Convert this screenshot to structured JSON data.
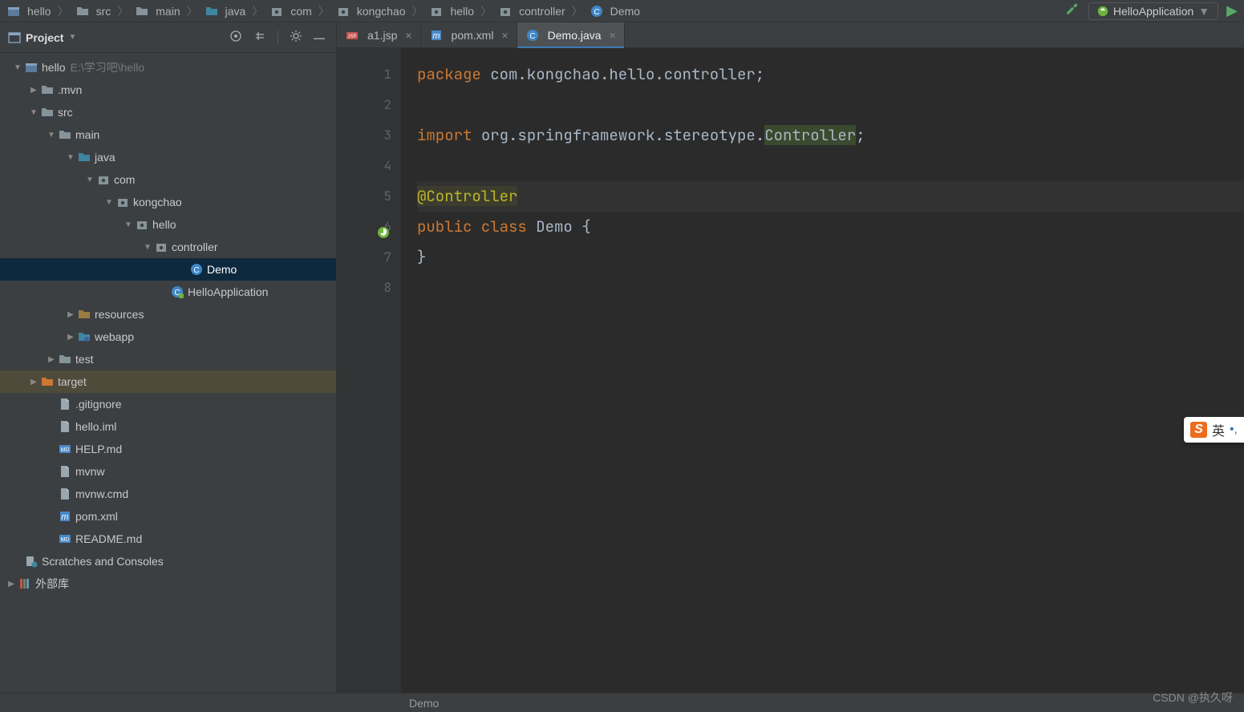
{
  "breadcrumbs": [
    "hello",
    "src",
    "main",
    "java",
    "com",
    "kongchao",
    "hello",
    "controller",
    "Demo"
  ],
  "runConfig": {
    "label": "HelloApplication"
  },
  "sidebar": {
    "title": "Project",
    "tree": [
      {
        "pad": 8,
        "arrow": "down",
        "icon": "module",
        "label": "hello",
        "dim": "E:\\学习吧\\hello"
      },
      {
        "pad": 28,
        "arrow": "right",
        "icon": "folder",
        "label": ".mvn"
      },
      {
        "pad": 28,
        "arrow": "down",
        "icon": "folder",
        "label": "src"
      },
      {
        "pad": 50,
        "arrow": "down",
        "icon": "folder",
        "label": "main"
      },
      {
        "pad": 74,
        "arrow": "down",
        "icon": "folder-src",
        "label": "java"
      },
      {
        "pad": 98,
        "arrow": "down",
        "icon": "package",
        "label": "com"
      },
      {
        "pad": 122,
        "arrow": "down",
        "icon": "package",
        "label": "kongchao"
      },
      {
        "pad": 146,
        "arrow": "down",
        "icon": "package",
        "label": "hello"
      },
      {
        "pad": 170,
        "arrow": "down",
        "icon": "package",
        "label": "controller"
      },
      {
        "pad": 214,
        "arrow": "",
        "icon": "class",
        "label": "Demo",
        "selected": true
      },
      {
        "pad": 190,
        "arrow": "",
        "icon": "spring-class",
        "label": "HelloApplication"
      },
      {
        "pad": 74,
        "arrow": "right",
        "icon": "folder-res",
        "label": "resources"
      },
      {
        "pad": 74,
        "arrow": "right",
        "icon": "folder-web",
        "label": "webapp"
      },
      {
        "pad": 50,
        "arrow": "right",
        "icon": "folder",
        "label": "test"
      },
      {
        "pad": 28,
        "arrow": "right",
        "icon": "folder-target",
        "label": "target",
        "hl": true
      },
      {
        "pad": 50,
        "arrow": "",
        "icon": "file",
        "label": ".gitignore"
      },
      {
        "pad": 50,
        "arrow": "",
        "icon": "file",
        "label": "hello.iml"
      },
      {
        "pad": 50,
        "arrow": "",
        "icon": "md",
        "label": "HELP.md"
      },
      {
        "pad": 50,
        "arrow": "",
        "icon": "file",
        "label": "mvnw"
      },
      {
        "pad": 50,
        "arrow": "",
        "icon": "file",
        "label": "mvnw.cmd"
      },
      {
        "pad": 50,
        "arrow": "",
        "icon": "maven",
        "label": "pom.xml"
      },
      {
        "pad": 50,
        "arrow": "",
        "icon": "md",
        "label": "README.md"
      },
      {
        "pad": 8,
        "arrow": "",
        "icon": "scratch",
        "label": "Scratches and Consoles"
      },
      {
        "pad": 0,
        "arrow": "right",
        "icon": "lib",
        "label": "外部库"
      }
    ]
  },
  "tabs": [
    {
      "icon": "jsp",
      "label": "a1.jsp",
      "active": false
    },
    {
      "icon": "maven",
      "label": "pom.xml",
      "active": false
    },
    {
      "icon": "class",
      "label": "Demo.java",
      "active": true
    }
  ],
  "code": {
    "lines": [
      {
        "n": 1,
        "tokens": [
          {
            "t": "package ",
            "c": "kw"
          },
          {
            "t": "com.kongchao.hello.controller;",
            "c": "cls"
          }
        ]
      },
      {
        "n": 2,
        "tokens": [
          {
            "t": "",
            "c": ""
          }
        ]
      },
      {
        "n": 3,
        "tokens": [
          {
            "t": "import ",
            "c": "kw"
          },
          {
            "t": "org.springframework.stereotype.",
            "c": "cls"
          },
          {
            "t": "Controller",
            "c": "hi"
          },
          {
            "t": ";",
            "c": "cls"
          }
        ]
      },
      {
        "n": 4,
        "tokens": [
          {
            "t": "",
            "c": ""
          }
        ]
      },
      {
        "n": 5,
        "current": true,
        "tokens": [
          {
            "t": "@Controller",
            "c": "ann"
          }
        ]
      },
      {
        "n": 6,
        "gicon": "spring",
        "tokens": [
          {
            "t": "public class ",
            "c": "kw"
          },
          {
            "t": "Demo {",
            "c": "cls"
          }
        ]
      },
      {
        "n": 7,
        "tokens": [
          {
            "t": "}",
            "c": "cls"
          }
        ]
      },
      {
        "n": 8,
        "tokens": [
          {
            "t": "",
            "c": ""
          }
        ]
      }
    ]
  },
  "status": {
    "context": "Demo"
  },
  "watermark": "CSDN @执久呀",
  "ime": {
    "badge": "S",
    "label": "英",
    "dots": "•,"
  }
}
